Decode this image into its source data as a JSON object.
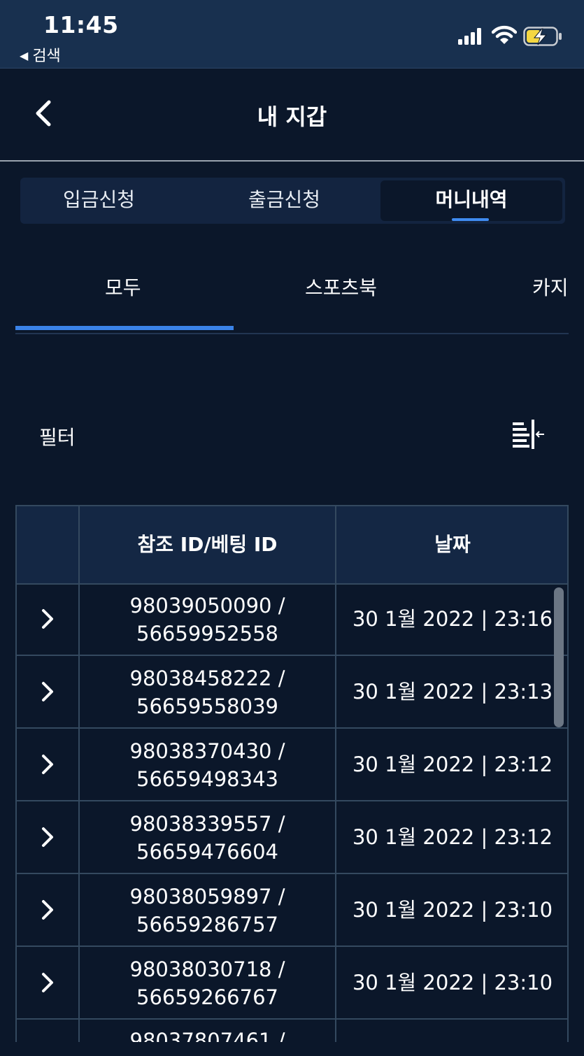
{
  "status_bar": {
    "time": "11:45",
    "back_app": "검색"
  },
  "header": {
    "title": "내 지갑"
  },
  "segment_tabs": [
    {
      "label": "입금신청"
    },
    {
      "label": "출금신청"
    },
    {
      "label": "머니내역"
    }
  ],
  "sub_tabs": [
    {
      "label": "모두"
    },
    {
      "label": "스포츠북"
    },
    {
      "label": "카지"
    }
  ],
  "filter": {
    "label": "필터"
  },
  "table": {
    "headers": [
      "",
      "참조 ID/베팅 ID",
      "날짜"
    ],
    "rows": [
      {
        "ref_id": "98039050090 /",
        "bet_id": "56659952558",
        "date": "30 1월 2022 | 23:16"
      },
      {
        "ref_id": "98038458222 /",
        "bet_id": "56659558039",
        "date": "30 1월 2022 | 23:13"
      },
      {
        "ref_id": "98038370430 /",
        "bet_id": "56659498343",
        "date": "30 1월 2022 | 23:12"
      },
      {
        "ref_id": "98038339557 /",
        "bet_id": "56659476604",
        "date": "30 1월 2022 | 23:12"
      },
      {
        "ref_id": "98038059897 /",
        "bet_id": "56659286757",
        "date": "30 1월 2022 | 23:10"
      },
      {
        "ref_id": "98038030718 /",
        "bet_id": "56659266767",
        "date": "30 1월 2022 | 23:10"
      },
      {
        "ref_id": "98037807461 /",
        "bet_id": "",
        "date": ""
      }
    ]
  },
  "colors": {
    "background": "#0b172a",
    "status_bar": "#18304f",
    "accent": "#3b83e8",
    "header_row": "#142744"
  }
}
